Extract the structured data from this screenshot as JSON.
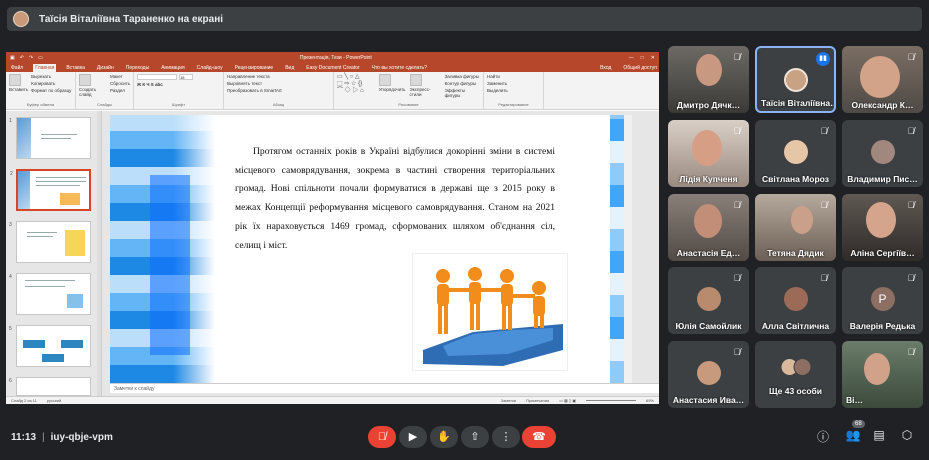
{
  "banner": {
    "title": "Таїсія Віталіївна Тараненко на екрані"
  },
  "ppt": {
    "window_title": "Презентація, Тези - PowerPoint",
    "window_controls": [
      "—",
      "□",
      "✕"
    ],
    "tabs": [
      "Файл",
      "Главная",
      "Вставка",
      "Дизайн",
      "Переходы",
      "Анимация",
      "Слайд-шоу",
      "Рецензирование",
      "Вид",
      "Easy Document Creator",
      "Что вы хотите сделать?"
    ],
    "sign_in": "Вход",
    "share": "Общий доступ",
    "ribbon": {
      "paste": "Вставить",
      "cut": "Вырезать",
      "copy": "Копировать",
      "format": "Формат по образцу",
      "clipboard_group": "Буфер обмена",
      "new_slide": "Создать слайд",
      "layout": "Макет",
      "reset": "Сбросить",
      "section": "Раздел",
      "slides_group": "Слайды",
      "font_size": "18",
      "font_group": "Шрифт",
      "text_dir": "Направление текста",
      "align_text": "Выровнять текст",
      "smartart": "Преобразовать в SmartArt",
      "paragraph_group": "Абзац",
      "arrange": "Упорядочить",
      "quick_styles": "Экспресс-стили",
      "fill": "Заливка фигуры",
      "outline": "Контур фигуры",
      "effects": "Эффекты фигуры",
      "drawing_group": "Рисование",
      "find": "Найти",
      "replace": "Заменить",
      "select": "Выделить",
      "editing_group": "Редактирование"
    },
    "slide_numbers": [
      "1",
      "2",
      "3",
      "4",
      "5",
      "6"
    ],
    "slide_text": "Протягом останніх років в Україні відбулися докорінні зміни в системі місцевого самоврядування, зокрема в частині створення територіальних громад. Нові спільноти почали формуватися в державі ще з 2015 року в межах Концепції реформування місцевого самоврядування. Станом на 2021 рік їх нараховується 1469 громад, сформованих шляхом об'єднання сіл, селищ і міст.",
    "notes_placeholder": "Заметки к слайду",
    "status": {
      "slide_of": "Слайд 2 из 11",
      "lang": "русский",
      "notes": "Заметки",
      "comments": "Примечания",
      "zoom": "69%"
    }
  },
  "participants": [
    {
      "name": "Дмитро Дячк…",
      "muted": true
    },
    {
      "name": "Таїсія Віталіївна…",
      "muted": false,
      "speaking": true
    },
    {
      "name": "Олександр К…",
      "muted": true
    },
    {
      "name": "Лідія Купченя",
      "muted": true
    },
    {
      "name": "Світлана Мороз",
      "muted": true
    },
    {
      "name": "Владимир Пис…",
      "muted": true
    },
    {
      "name": "Анастасія Ед…",
      "muted": true
    },
    {
      "name": "Тетяна Дядик",
      "muted": true
    },
    {
      "name": "Аліна Сергіїв…",
      "muted": true
    },
    {
      "name": "Юлія Самойлик",
      "muted": true
    },
    {
      "name": "Алла Світлична",
      "muted": true
    },
    {
      "name": "Валерія Редька",
      "muted": true,
      "letter": "Р"
    },
    {
      "name": "Анастасия Ива…",
      "muted": true
    },
    {
      "name": "Ще 43 особи"
    },
    {
      "name": "Ві…",
      "muted": true
    }
  ],
  "meeting": {
    "time": "11:13",
    "code": "iuy-qbje-vpm",
    "people_count": "68"
  },
  "icons": {
    "mic_off": "mic-off-icon",
    "camera": "camera-icon",
    "hand": "raise-hand-icon",
    "present": "present-icon",
    "more": "more-options-icon",
    "end": "end-call-icon",
    "info": "info-icon",
    "people": "people-icon",
    "chat": "chat-icon",
    "activities": "activities-icon"
  },
  "colors": {
    "end_call": "#ea4335",
    "ppt_brand": "#b7472a",
    "active_speaker": "#8ab4f8"
  }
}
